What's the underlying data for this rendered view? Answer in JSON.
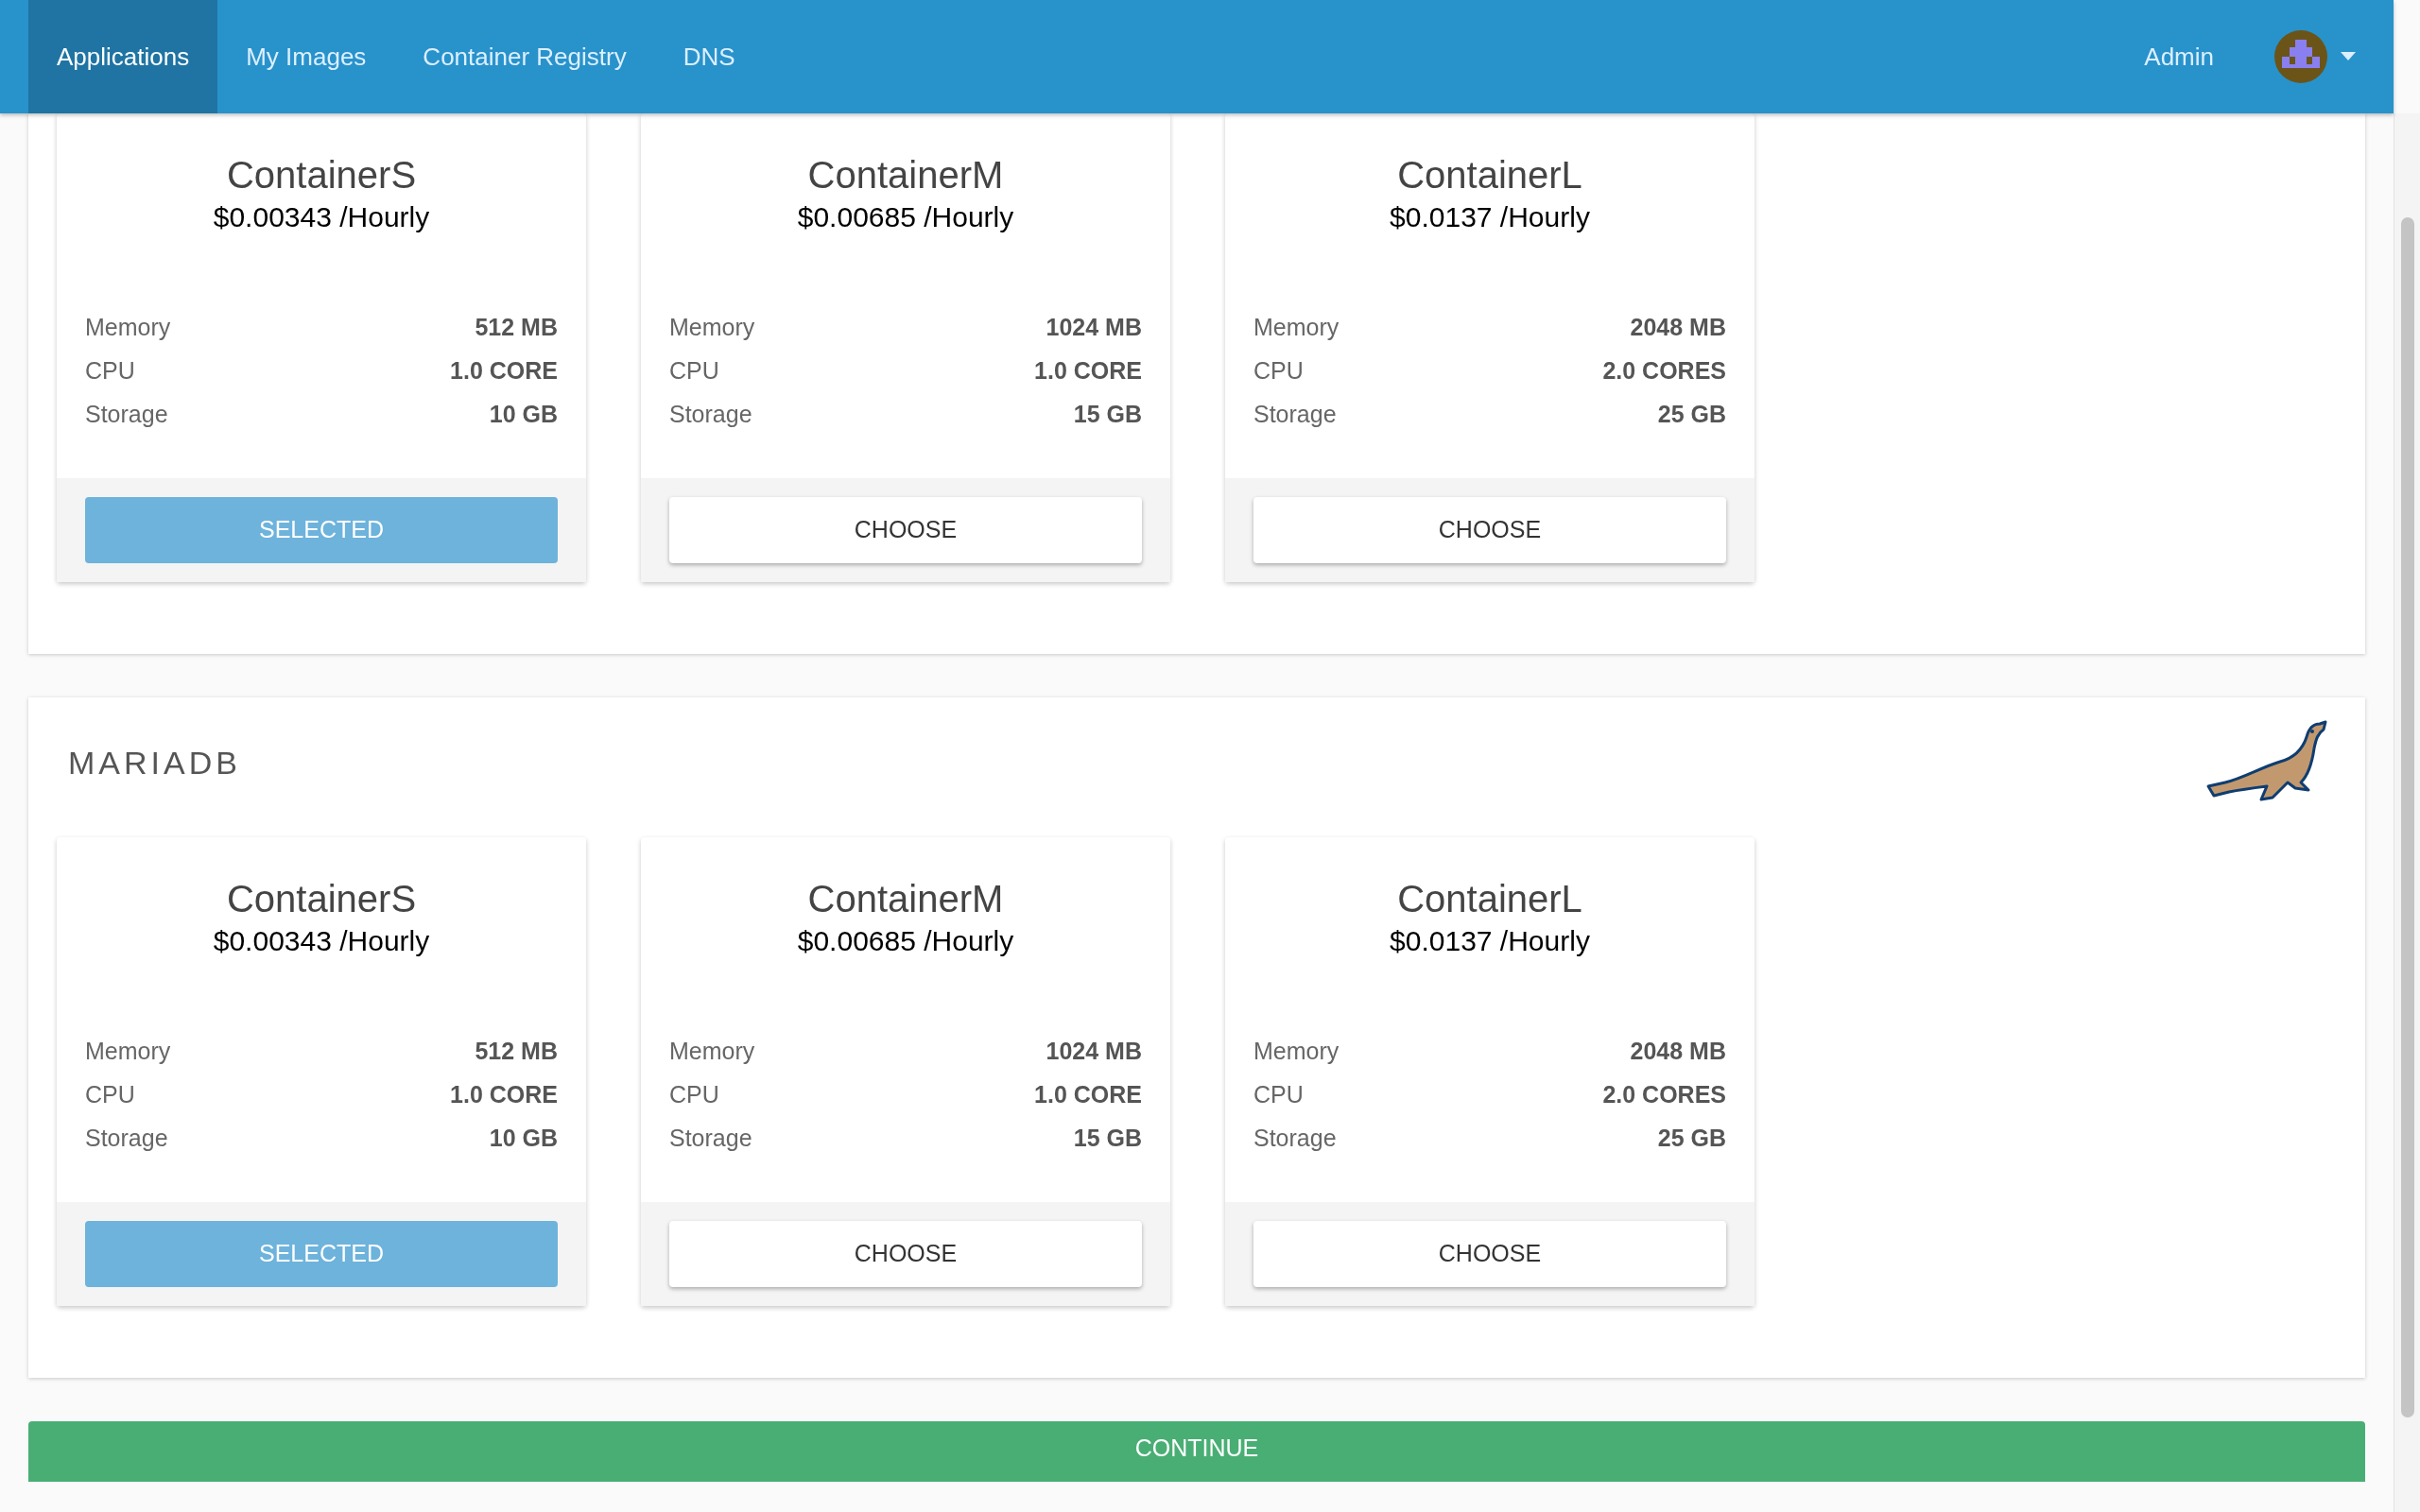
{
  "nav": {
    "tabs": [
      {
        "label": "Applications",
        "selected": true
      },
      {
        "label": "My Images",
        "selected": false
      },
      {
        "label": "Container Registry",
        "selected": false
      },
      {
        "label": "DNS",
        "selected": false
      }
    ],
    "user": "Admin"
  },
  "sections": [
    {
      "cards": [
        {
          "name": "ContainerS",
          "price": "$0.00343 /Hourly",
          "specs": [
            {
              "label": "Memory",
              "value": "512 MB"
            },
            {
              "label": "CPU",
              "value": "1.0 CORE"
            },
            {
              "label": "Storage",
              "value": "10 GB"
            }
          ],
          "button": {
            "label": "SELECTED",
            "selected": true
          }
        },
        {
          "name": "ContainerM",
          "price": "$0.00685 /Hourly",
          "specs": [
            {
              "label": "Memory",
              "value": "1024 MB"
            },
            {
              "label": "CPU",
              "value": "1.0 CORE"
            },
            {
              "label": "Storage",
              "value": "15 GB"
            }
          ],
          "button": {
            "label": "CHOOSE",
            "selected": false
          }
        },
        {
          "name": "ContainerL",
          "price": "$0.0137 /Hourly",
          "specs": [
            {
              "label": "Memory",
              "value": "2048 MB"
            },
            {
              "label": "CPU",
              "value": "2.0 CORES"
            },
            {
              "label": "Storage",
              "value": "25 GB"
            }
          ],
          "button": {
            "label": "CHOOSE",
            "selected": false
          }
        }
      ]
    },
    {
      "title": "MARIADB",
      "cards": [
        {
          "name": "ContainerS",
          "price": "$0.00343 /Hourly",
          "specs": [
            {
              "label": "Memory",
              "value": "512 MB"
            },
            {
              "label": "CPU",
              "value": "1.0 CORE"
            },
            {
              "label": "Storage",
              "value": "10 GB"
            }
          ],
          "button": {
            "label": "SELECTED",
            "selected": true
          }
        },
        {
          "name": "ContainerM",
          "price": "$0.00685 /Hourly",
          "specs": [
            {
              "label": "Memory",
              "value": "1024 MB"
            },
            {
              "label": "CPU",
              "value": "1.0 CORE"
            },
            {
              "label": "Storage",
              "value": "15 GB"
            }
          ],
          "button": {
            "label": "CHOOSE",
            "selected": false
          }
        },
        {
          "name": "ContainerL",
          "price": "$0.0137 /Hourly",
          "specs": [
            {
              "label": "Memory",
              "value": "2048 MB"
            },
            {
              "label": "CPU",
              "value": "2.0 CORES"
            },
            {
              "label": "Storage",
              "value": "25 GB"
            }
          ],
          "button": {
            "label": "CHOOSE",
            "selected": false
          }
        }
      ]
    }
  ],
  "continue": "CONTINUE"
}
